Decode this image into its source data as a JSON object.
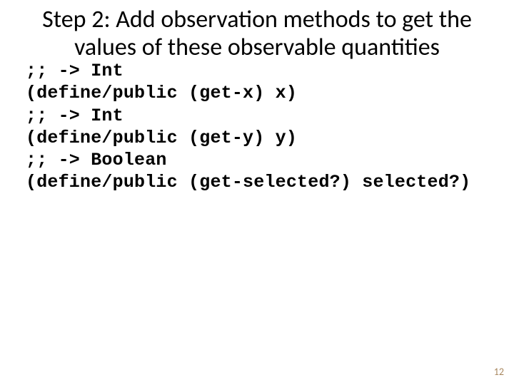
{
  "title": "Step 2: Add observation methods to get the values of these observable quantities",
  "code": {
    "l1": ";; -> Int",
    "l2": "(define/public (get-x) x)",
    "l3": ";; -> Int",
    "l4": "(define/public (get-y) y)",
    "l5": ";; -> Boolean",
    "l6": "(define/public (get-selected?) selected?)"
  },
  "page_number": "12"
}
